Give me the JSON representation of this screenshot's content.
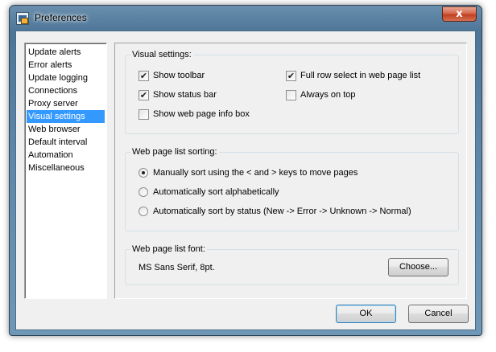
{
  "window": {
    "title": "Preferences",
    "close_glyph": "x",
    "app_icon": "app-icon"
  },
  "sidebar": {
    "items": [
      {
        "label": "Update alerts"
      },
      {
        "label": "Error alerts"
      },
      {
        "label": "Update logging"
      },
      {
        "label": "Connections"
      },
      {
        "label": "Proxy server"
      },
      {
        "label": "Visual settings",
        "selected": true
      },
      {
        "label": "Web browser"
      },
      {
        "label": "Default interval"
      },
      {
        "label": "Automation"
      },
      {
        "label": "Miscellaneous"
      }
    ]
  },
  "visual_settings": {
    "legend": "Visual settings:",
    "show_toolbar": {
      "label": "Show toolbar",
      "checked": true
    },
    "show_status_bar": {
      "label": "Show status bar",
      "checked": true
    },
    "show_info_box": {
      "label": "Show web page info box",
      "checked": false
    },
    "full_row_select": {
      "label": "Full row select in web page list",
      "checked": true
    },
    "always_on_top": {
      "label": "Always on top",
      "checked": false
    }
  },
  "sorting": {
    "legend": "Web page list sorting:",
    "options": [
      {
        "label": "Manually sort using the < and > keys to move pages",
        "selected": true
      },
      {
        "label": "Automatically sort alphabetically",
        "selected": false
      },
      {
        "label": "Automatically sort by status (New -> Error -> Unknown -> Normal)",
        "selected": false
      }
    ]
  },
  "font": {
    "legend": "Web page list font:",
    "value": "MS Sans Serif, 8pt.",
    "choose_label": "Choose..."
  },
  "footer": {
    "ok_label": "OK",
    "cancel_label": "Cancel"
  },
  "check_glyph": "✔",
  "colors": {
    "selection": "#3399ff",
    "dialog_bg": "#f0f0f0",
    "close_button": "#c1401f"
  }
}
